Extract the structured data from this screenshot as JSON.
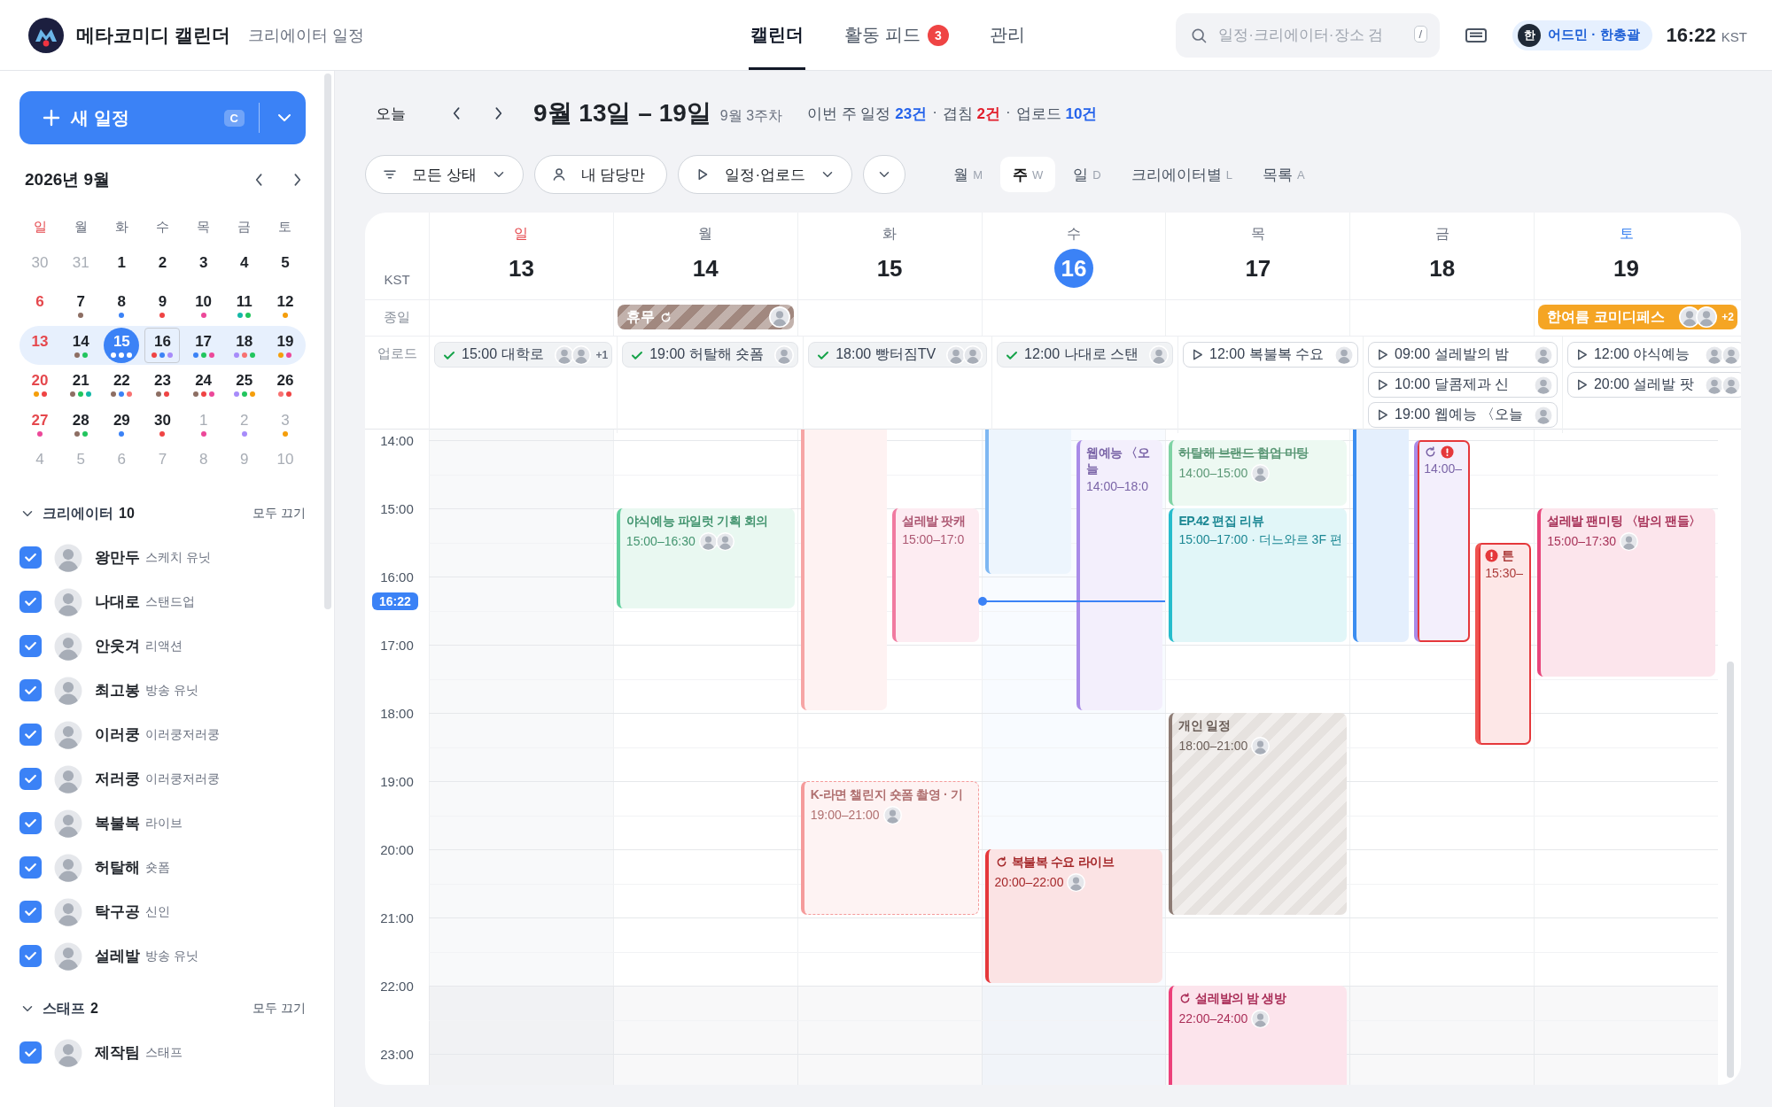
{
  "app": {
    "title": "메타코미디 캘린더",
    "subtitle": "크리에이터 일정"
  },
  "nav": [
    {
      "label": "캘린더",
      "selected": true
    },
    {
      "label": "활동 피드",
      "selected": false,
      "badge": "3"
    },
    {
      "label": "관리",
      "selected": false
    }
  ],
  "search": {
    "placeholder": "일정·크리에이터·장소 검",
    "shortcut": "/"
  },
  "user": {
    "initial": "한",
    "label": "어드민 · 한총괄"
  },
  "clock": {
    "time": "16:22",
    "zone": "KST"
  },
  "new_event": {
    "label": "새 일정",
    "shortcut": "C"
  },
  "mini_calendar": {
    "title": "2026년 9월",
    "weekdays": [
      "일",
      "월",
      "화",
      "수",
      "목",
      "금",
      "토"
    ],
    "weeks": [
      {
        "selected": false,
        "days": [
          {
            "day": "30",
            "muted": true,
            "selected": false,
            "today": false
          },
          {
            "day": "31",
            "muted": true,
            "selected": false,
            "today": false
          },
          {
            "day": "1",
            "muted": false,
            "selected": false,
            "today": false
          },
          {
            "day": "2",
            "muted": false,
            "selected": false,
            "today": false
          },
          {
            "day": "3",
            "muted": false,
            "selected": false,
            "today": false
          },
          {
            "day": "4",
            "muted": false,
            "selected": false,
            "today": false
          },
          {
            "day": "5",
            "muted": false,
            "selected": false,
            "today": false
          }
        ]
      },
      {
        "selected": false,
        "days": [
          {
            "day": "6",
            "muted": false,
            "selected": false,
            "today": false
          },
          {
            "day": "7",
            "muted": false,
            "selected": false,
            "today": false,
            "dots": [
              {
                "color": "#8d6e63"
              }
            ]
          },
          {
            "day": "8",
            "muted": false,
            "selected": false,
            "today": false,
            "dots": [
              {
                "color": "#3b82f6"
              }
            ]
          },
          {
            "day": "9",
            "muted": false,
            "selected": false,
            "today": false,
            "dots": [
              {
                "color": "#ef4444"
              }
            ]
          },
          {
            "day": "10",
            "muted": false,
            "selected": false,
            "today": false,
            "dots": [
              {
                "color": "#ec4899"
              }
            ]
          },
          {
            "day": "11",
            "muted": false,
            "selected": false,
            "today": false,
            "dots": [
              {
                "color": "#14b8a6"
              },
              {
                "color": "#22c55e"
              }
            ]
          },
          {
            "day": "12",
            "muted": false,
            "selected": false,
            "today": false,
            "dots": [
              {
                "color": "#f59e0b"
              }
            ]
          }
        ]
      },
      {
        "selected": true,
        "days": [
          {
            "day": "13",
            "muted": false,
            "selected": false,
            "today": false
          },
          {
            "day": "14",
            "muted": false,
            "selected": false,
            "today": false,
            "dots": [
              {
                "color": "#8d6e63"
              },
              {
                "color": "#22c55e"
              }
            ]
          },
          {
            "day": "15",
            "muted": false,
            "selected": true,
            "today": false,
            "dots": [
              {
                "color": "#ffffff"
              },
              {
                "color": "#ffffff"
              },
              {
                "color": "#ffffff"
              }
            ]
          },
          {
            "day": "16",
            "muted": false,
            "selected": false,
            "today": true,
            "dots": [
              {
                "color": "#ef4444"
              },
              {
                "color": "#3b82f6"
              },
              {
                "color": "#a78bfa"
              }
            ]
          },
          {
            "day": "17",
            "muted": false,
            "selected": false,
            "today": false,
            "dots": [
              {
                "color": "#3b82f6"
              },
              {
                "color": "#22c55e"
              },
              {
                "color": "#ec4899"
              }
            ]
          },
          {
            "day": "18",
            "muted": false,
            "selected": false,
            "today": false,
            "dots": [
              {
                "color": "#a78bfa"
              },
              {
                "color": "#f87171"
              },
              {
                "color": "#22c55e"
              }
            ]
          },
          {
            "day": "19",
            "muted": false,
            "selected": false,
            "today": false,
            "dots": [
              {
                "color": "#f59e0b"
              },
              {
                "color": "#ec4899"
              }
            ]
          }
        ]
      },
      {
        "selected": false,
        "days": [
          {
            "day": "20",
            "muted": false,
            "selected": false,
            "today": false,
            "dots": [
              {
                "color": "#f59e0b"
              },
              {
                "color": "#ef4444"
              }
            ]
          },
          {
            "day": "21",
            "muted": false,
            "selected": false,
            "today": false,
            "dots": [
              {
                "color": "#8d6e63"
              },
              {
                "color": "#22c55e"
              },
              {
                "color": "#14b8a6"
              }
            ]
          },
          {
            "day": "22",
            "muted": false,
            "selected": false,
            "today": false,
            "dots": [
              {
                "color": "#8d6e63"
              },
              {
                "color": "#3b82f6"
              },
              {
                "color": "#f87171"
              }
            ]
          },
          {
            "day": "23",
            "muted": false,
            "selected": false,
            "today": false,
            "dots": [
              {
                "color": "#8d6e63"
              },
              {
                "color": "#ef4444"
              }
            ]
          },
          {
            "day": "24",
            "muted": false,
            "selected": false,
            "today": false,
            "dots": [
              {
                "color": "#8d6e63"
              },
              {
                "color": "#ef4444"
              },
              {
                "color": "#ec4899"
              }
            ]
          },
          {
            "day": "25",
            "muted": false,
            "selected": false,
            "today": false,
            "dots": [
              {
                "color": "#a78bfa"
              },
              {
                "color": "#22c55e"
              },
              {
                "color": "#f59e0b"
              }
            ]
          },
          {
            "day": "26",
            "muted": false,
            "selected": false,
            "today": false,
            "dots": [
              {
                "color": "#f87171"
              },
              {
                "color": "#ef4444"
              }
            ]
          }
        ]
      },
      {
        "selected": false,
        "days": [
          {
            "day": "27",
            "muted": false,
            "selected": false,
            "today": false,
            "dots": [
              {
                "color": "#ec4899"
              }
            ]
          },
          {
            "day": "28",
            "muted": false,
            "selected": false,
            "today": false,
            "dots": [
              {
                "color": "#8d6e63"
              },
              {
                "color": "#22c55e"
              }
            ]
          },
          {
            "day": "29",
            "muted": false,
            "selected": false,
            "today": false,
            "dots": [
              {
                "color": "#3b82f6"
              }
            ]
          },
          {
            "day": "30",
            "muted": false,
            "selected": false,
            "today": false,
            "dots": [
              {
                "color": "#ef4444"
              }
            ]
          },
          {
            "day": "1",
            "muted": true,
            "selected": false,
            "today": false,
            "dots": [
              {
                "color": "#ec4899"
              }
            ]
          },
          {
            "day": "2",
            "muted": true,
            "selected": false,
            "today": false,
            "dots": [
              {
                "color": "#a78bfa"
              }
            ]
          },
          {
            "day": "3",
            "muted": true,
            "selected": false,
            "today": false,
            "dots": [
              {
                "color": "#f59e0b"
              }
            ]
          }
        ]
      },
      {
        "selected": false,
        "days": [
          {
            "day": "4",
            "muted": true,
            "selected": false,
            "today": false
          },
          {
            "day": "5",
            "muted": true,
            "selected": false,
            "today": false
          },
          {
            "day": "6",
            "muted": true,
            "selected": false,
            "today": false
          },
          {
            "day": "7",
            "muted": true,
            "selected": false,
            "today": false
          },
          {
            "day": "8",
            "muted": true,
            "selected": false,
            "today": false
          },
          {
            "day": "9",
            "muted": true,
            "selected": false,
            "today": false
          },
          {
            "day": "10",
            "muted": true,
            "selected": false,
            "today": false
          }
        ]
      }
    ]
  },
  "groups": [
    {
      "title": "크리에이터",
      "count": "10",
      "action": "모두 끄기",
      "expanded": true,
      "items": [
        {
          "name": "왕만두",
          "role": "스케치 유닛",
          "checked": true
        },
        {
          "name": "나대로",
          "role": "스탠드업",
          "checked": true
        },
        {
          "name": "안웃겨",
          "role": "리액션",
          "checked": true
        },
        {
          "name": "최고봉",
          "role": "방송 유닛",
          "checked": true
        },
        {
          "name": "이러쿵",
          "role": "이러쿵저러쿵",
          "checked": true
        },
        {
          "name": "저러쿵",
          "role": "이러쿵저러쿵",
          "checked": true
        },
        {
          "name": "복불복",
          "role": "라이브",
          "checked": true
        },
        {
          "name": "허탈해",
          "role": "숏폼",
          "checked": true
        },
        {
          "name": "탁구공",
          "role": "신인",
          "checked": true
        },
        {
          "name": "설레발",
          "role": "방송 유닛",
          "checked": true
        }
      ]
    },
    {
      "title": "스태프",
      "count": "2",
      "action": "모두 끄기",
      "expanded": true,
      "items": [
        {
          "name": "제작팀",
          "role": "스태프",
          "checked": true
        }
      ]
    }
  ],
  "toolbar": {
    "today": "오늘",
    "range": "9월 13일 – 19일",
    "week": "9월 3주차",
    "summary": [
      {
        "label": "이번 주 일정",
        "count": "23건",
        "kind": "normal"
      },
      {
        "separator": "·",
        "label": "겹침",
        "count": "2건",
        "kind": "alert"
      },
      {
        "separator": "·",
        "label": "업로드",
        "count": "10건",
        "kind": "normal"
      }
    ]
  },
  "filters": [
    {
      "label": "모든 상태",
      "kind": "filter",
      "dropdown": true
    },
    {
      "label": "내 담당만",
      "kind": "person",
      "dropdown": false
    },
    {
      "label": "일정·업로드",
      "kind": "play",
      "dropdown": true
    },
    {
      "kind": "more",
      "dropdown": true
    }
  ],
  "views": [
    {
      "label": "월",
      "key": "M",
      "selected": false
    },
    {
      "label": "주",
      "key": "W",
      "selected": true
    },
    {
      "label": "일",
      "key": "D",
      "selected": false
    },
    {
      "label": "크리에이터별",
      "key": "L",
      "selected": false
    },
    {
      "label": "목록",
      "key": "A",
      "selected": false
    }
  ],
  "calendar": {
    "zone": "KST",
    "allday_label": "종일",
    "upload_label": "업로드",
    "now": "16:22",
    "hours": [
      "14:00",
      "15:00",
      "16:00",
      "17:00",
      "18:00",
      "19:00",
      "20:00",
      "21:00",
      "22:00",
      "23:00"
    ],
    "days": [
      {
        "weekday": "일",
        "date": "13",
        "today": false,
        "uploads": [
          {
            "done": true,
            "time": "15:00",
            "title": "대학로",
            "assignees": [
              {
                "kind": "person"
              },
              {
                "kind": "person"
              }
            ],
            "more": "+1"
          }
        ]
      },
      {
        "weekday": "월",
        "date": "14",
        "today": false,
        "allday": [
          {
            "title": "휴무",
            "kind": "hatched",
            "color": "#a1887f",
            "recurring": true,
            "assignees": [
              {
                "kind": "person"
              }
            ]
          }
        ],
        "uploads": [
          {
            "done": true,
            "time": "19:00",
            "title": "허탈해 숏폼",
            "assignees": [
              {
                "kind": "person"
              }
            ]
          }
        ],
        "events": [
          {
            "title": "야식예능 파일럿 기획 회의",
            "time": "15:00–16:30",
            "kind": "solid",
            "color": "#5fcf9b",
            "recurring": false,
            "conflict": false,
            "done": false,
            "assignees": [
              {
                "kind": "person"
              },
              {
                "kind": "person"
              }
            ]
          }
        ]
      },
      {
        "weekday": "화",
        "date": "15",
        "today": false,
        "uploads": [
          {
            "done": true,
            "time": "18:00",
            "title": "빵터짐TV",
            "assignees": [
              {
                "kind": "person"
              },
              {
                "kind": "person"
              }
            ]
          }
        ],
        "events": [
          {
            "kind": "solid",
            "color": "#f6a5a5",
            "conflict": false
          },
          {
            "title": "설레발 팟캐",
            "time": "15:00–17:0",
            "kind": "solid",
            "color": "#f07aa0",
            "recurring": false,
            "conflict": false,
            "done": false
          },
          {
            "title": "K-라면 챌린지 숏폼 촬영 · 기",
            "time": "19:00–21:00",
            "kind": "tentative",
            "color": "#f59b9b",
            "recurring": false,
            "conflict": false,
            "done": false,
            "assignees": [
              {
                "kind": "person"
              }
            ]
          }
        ]
      },
      {
        "weekday": "수",
        "date": "16",
        "today": true,
        "uploads": [
          {
            "done": true,
            "time": "12:00",
            "title": "나대로 스탠",
            "assignees": [
              {
                "kind": "person"
              }
            ]
          }
        ],
        "events": [
          {
            "kind": "solid",
            "color": "#7db7f2",
            "conflict": false
          },
          {
            "title": "웹예능 〈오늘",
            "time": "14:00–18:0",
            "kind": "solid",
            "color": "#a98be8",
            "recurring": false,
            "conflict": false,
            "done": false
          },
          {
            "title": "복불복 수요 라이브",
            "time": "20:00–22:00",
            "kind": "solid",
            "color": "#e5383b",
            "recurring": true,
            "conflict": false,
            "done": false,
            "assignees": [
              {
                "kind": "person"
              }
            ]
          }
        ]
      },
      {
        "weekday": "목",
        "date": "17",
        "today": false,
        "uploads": [
          {
            "done": false,
            "time": "12:00",
            "title": "복불복 수요",
            "assignees": [
              {
                "kind": "person"
              }
            ]
          }
        ],
        "events": [
          {
            "title": "허탈해 브랜드 협업 미팅",
            "time": "14:00–15:00",
            "kind": "solid",
            "color": "#7fd3a4",
            "recurring": false,
            "conflict": false,
            "done": true,
            "assignees": [
              {
                "kind": "person"
              }
            ]
          },
          {
            "title": "EP.42 편집 리뷰",
            "time": "15:00–17:00 · 더느와르 3F 편",
            "kind": "solid",
            "color": "#26bccc",
            "recurring": false,
            "conflict": false,
            "done": false
          },
          {
            "title": "개인 일정",
            "time": "18:00–21:00",
            "kind": "hatched",
            "color": "#8d7b74",
            "recurring": false,
            "conflict": false,
            "done": false,
            "assignees": [
              {
                "kind": "person"
              }
            ]
          },
          {
            "title": "설레발의 밤 생방",
            "time": "22:00–24:00",
            "kind": "solid",
            "color": "#ec407a",
            "recurring": true,
            "conflict": false,
            "done": false,
            "assignees": [
              {
                "kind": "person"
              }
            ]
          }
        ]
      },
      {
        "weekday": "금",
        "date": "18",
        "today": false,
        "uploads": [
          {
            "done": false,
            "time": "09:00",
            "title": "설레발의 밤",
            "assignees": [
              {
                "kind": "person"
              }
            ]
          },
          {
            "done": false,
            "time": "10:00",
            "title": "달콤제과 신",
            "assignees": [
              {
                "kind": "person"
              }
            ]
          },
          {
            "done": false,
            "time": "19:00",
            "title": "웹예능 〈오늘",
            "assignees": [
              {
                "kind": "person"
              }
            ]
          }
        ],
        "events": [
          {
            "kind": "solid",
            "color": "#3b8df0",
            "conflict": false
          },
          {
            "time": "14:00–",
            "kind": "solid",
            "color": "#a98be8",
            "recurring": true,
            "conflict": true
          },
          {
            "title": "튼",
            "time": "15:30–",
            "kind": "solid",
            "color": "#ef5350",
            "recurring": false,
            "conflict": true,
            "done": false
          }
        ]
      },
      {
        "weekday": "토",
        "date": "19",
        "today": false,
        "allday": [
          {
            "title": "한여름 코미디페스",
            "kind": "solid",
            "color": "#f5a524",
            "recurring": false,
            "assignees": [
              {
                "kind": "person"
              },
              {
                "kind": "person"
              }
            ],
            "more": "+2"
          }
        ],
        "uploads": [
          {
            "done": false,
            "time": "12:00",
            "title": "야식예능",
            "assignees": [
              {
                "kind": "person"
              },
              {
                "kind": "person"
              }
            ]
          },
          {
            "done": false,
            "time": "20:00",
            "title": "설레발 팟",
            "assignees": [
              {
                "kind": "person"
              },
              {
                "kind": "person"
              }
            ]
          }
        ],
        "events": [
          {
            "title": "설레발 팬미팅 〈밤의 팬들〉",
            "time": "15:00–17:30",
            "kind": "solid",
            "color": "#e8457a",
            "recurring": false,
            "conflict": false,
            "done": false,
            "assignees": [
              {
                "kind": "person"
              }
            ]
          }
        ]
      }
    ]
  }
}
